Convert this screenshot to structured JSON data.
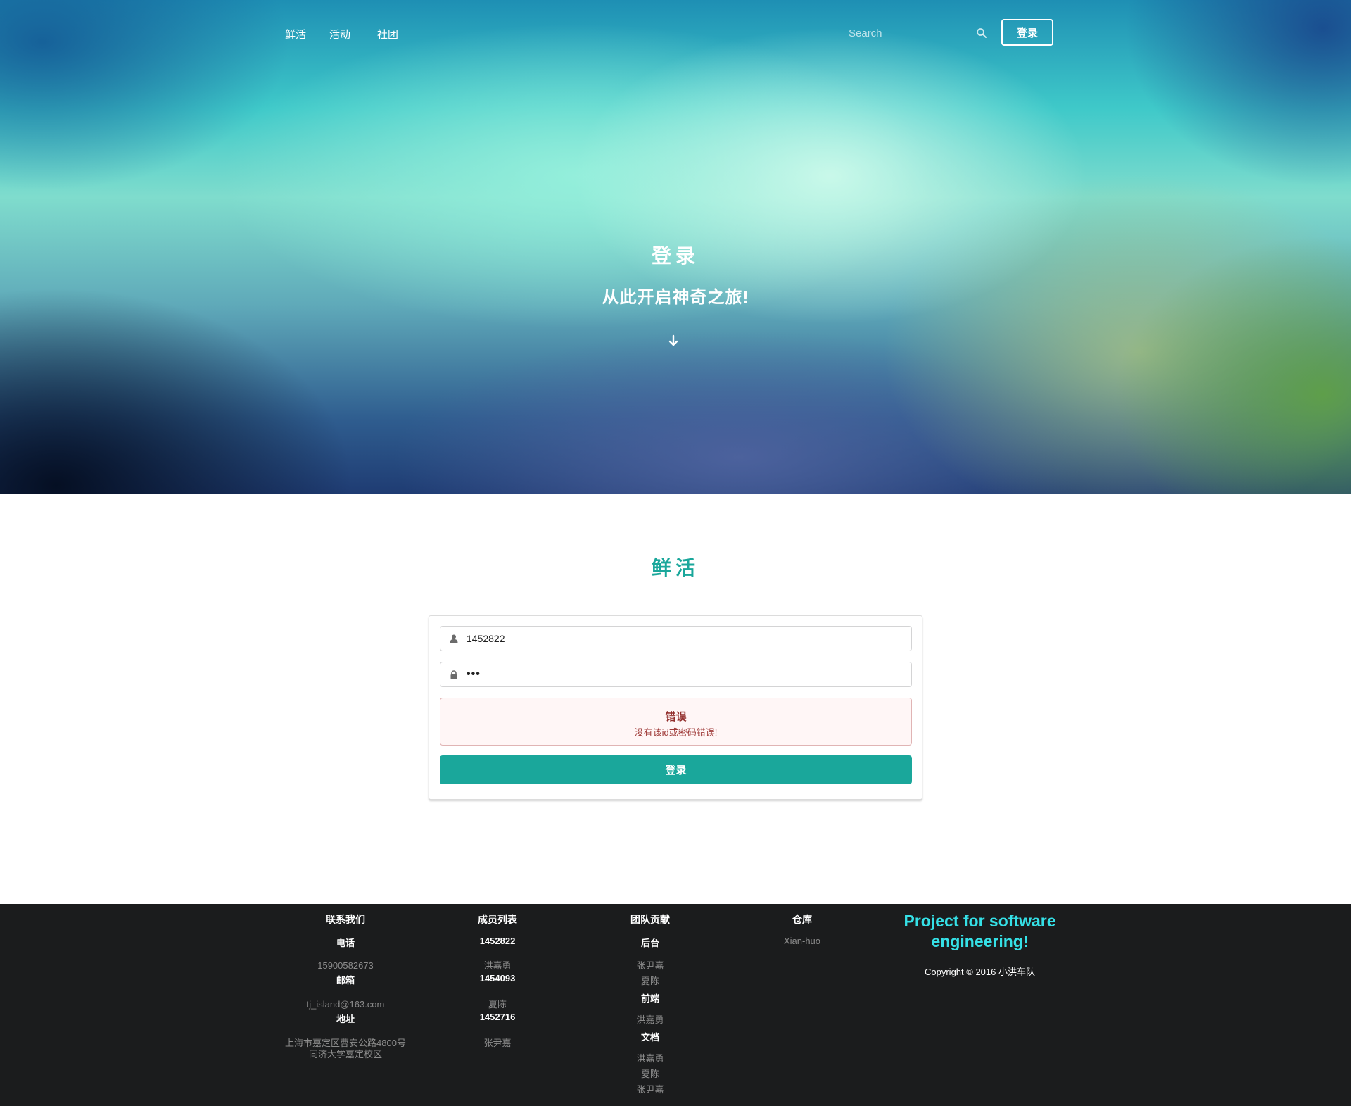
{
  "nav": {
    "links": [
      "鲜活",
      "活动",
      "社团"
    ],
    "search_placeholder": "Search",
    "login_button": "登录"
  },
  "hero": {
    "title": "登录",
    "subtitle": "从此开启神奇之旅!"
  },
  "main": {
    "title": "鲜活",
    "form": {
      "username_value": "1452822",
      "password_value": "•••",
      "error_title": "错误",
      "error_message": "没有该id或密码错误!",
      "submit_label": "登录"
    }
  },
  "footer": {
    "contact": {
      "title": "联系我们",
      "phone_label": "电话",
      "phone": "15900582673",
      "email_label": "邮箱",
      "email": "tj_island@163.com",
      "address_label": "地址",
      "address_line1": "上海市嘉定区曹安公路4800号",
      "address_line2": "同济大学嘉定校区"
    },
    "members": {
      "title": "成员列表",
      "items": [
        {
          "id": "1452822",
          "name": "洪嘉勇"
        },
        {
          "id": "1454093",
          "name": "夏陈"
        },
        {
          "id": "1452716",
          "name": "张尹嘉"
        }
      ]
    },
    "contribution": {
      "title": "团队贡献",
      "groups": [
        {
          "label": "后台",
          "names": [
            "张尹嘉",
            "夏陈"
          ]
        },
        {
          "label": "前端",
          "names": [
            "洪嘉勇"
          ]
        },
        {
          "label": "文档",
          "names": [
            "洪嘉勇",
            "夏陈",
            "张尹嘉"
          ]
        }
      ]
    },
    "repo": {
      "title": "仓库",
      "name": "Xian-huo"
    },
    "project": "Project for software engineering!",
    "copyright": "Copyright © 2016 小洪车队"
  },
  "colors": {
    "accent": "#1aa79b",
    "footer_bg": "#1b1c1d",
    "project_text": "#35e0e6",
    "error_bg": "#fff6f6",
    "error_text": "#912d2b"
  }
}
